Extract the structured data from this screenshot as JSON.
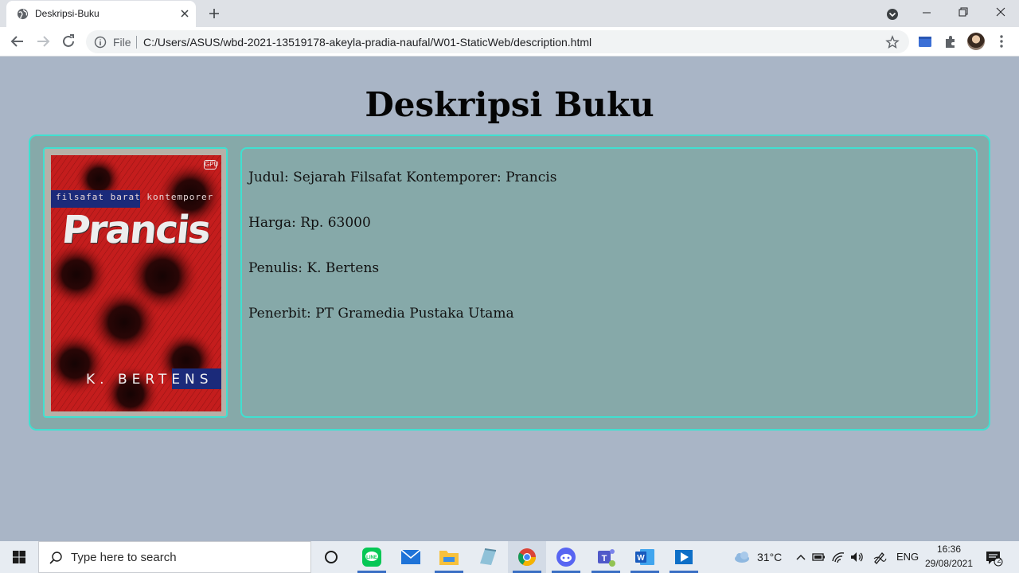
{
  "browser": {
    "tab_title": "Deskripsi-Buku",
    "omnibox_scheme_label": "File",
    "url": "C:/Users/ASUS/wbd-2021-13519178-akeyla-pradia-naufal/W01-StaticWeb/description.html"
  },
  "page": {
    "title": "Deskripsi Buku",
    "cover": {
      "series": "filsafat barat kontemporer",
      "title": "Prancis",
      "author": "K. BERTENS",
      "publisher_logo": "GPU"
    },
    "details": [
      {
        "label": "Judul",
        "value": "Sejarah Filsafat Kontemporer: Prancis",
        "text": "Judul: Sejarah Filsafat Kontemporer: Prancis"
      },
      {
        "label": "Harga",
        "value": "Rp. 63000",
        "text": "Harga: Rp. 63000"
      },
      {
        "label": "Penulis",
        "value": "K. Bertens",
        "text": "Penulis: K. Bertens"
      },
      {
        "label": "Penerbit",
        "value": "PT Gramedia Pustaka Utama",
        "text": "Penerbit: PT Gramedia Pustaka Utama"
      }
    ]
  },
  "taskbar": {
    "search_placeholder": "Type here to search",
    "weather": "31°C",
    "language": "ENG",
    "time": "16:36",
    "date": "29/08/2021",
    "notification_count": "2",
    "apps": [
      "task-view-icon",
      "line-icon",
      "mail-icon",
      "file-explorer-icon",
      "notepad-icon",
      "chrome-icon",
      "discord-icon",
      "teams-icon",
      "word-icon",
      "media-player-icon"
    ]
  },
  "colors": {
    "page_background": "#a9b5c6",
    "box_background": "#86a9a9",
    "box_border": "#40e0d0"
  }
}
